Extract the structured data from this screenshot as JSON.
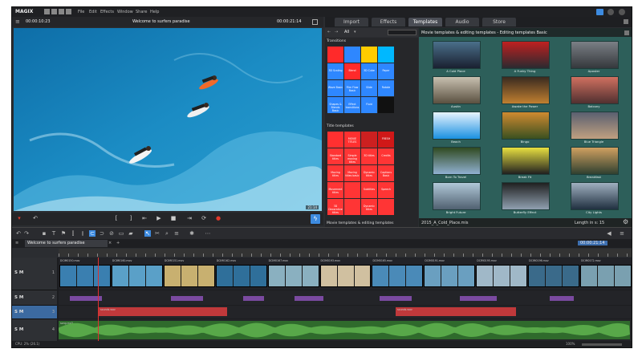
{
  "app": {
    "logo": "MAGIX"
  },
  "menu": [
    "File",
    "Edit",
    "Effects",
    "Window",
    "Share",
    "Help"
  ],
  "preview": {
    "timecode_left": "00:00:10:23",
    "title": "Welcome to surfers paradise",
    "timecode_right": "00:00:21:14",
    "progress_label": "21:14"
  },
  "tabs": [
    "Import",
    "Effects",
    "Templates",
    "Audio",
    "Store"
  ],
  "active_tab": "Templates",
  "library": {
    "filter": "All",
    "sections": [
      "Transitions",
      "Title templates",
      "Movie templates & editing templates"
    ],
    "transition_tiles": [
      {
        "label": "",
        "color": "#ff2a2a"
      },
      {
        "label": "",
        "color": "#2e87ff"
      },
      {
        "label": "",
        "color": "#ffcc00"
      },
      {
        "label": "",
        "color": "#00b8ff"
      },
      {
        "label": "3D Scaling",
        "color": "#2e87ff"
      },
      {
        "label": "Blend",
        "color": "#ff2a2a"
      },
      {
        "label": "3D Cube",
        "color": "#2e87ff"
      },
      {
        "label": "Paper",
        "color": "#2e87ff"
      },
      {
        "label": "Wave Basic",
        "color": "#2e87ff"
      },
      {
        "label": "Film Flow Basic",
        "color": "#2e87ff"
      },
      {
        "label": "Slide",
        "color": "#2e87ff"
      },
      {
        "label": "Rotate",
        "color": "#2e87ff"
      },
      {
        "label": "Shapes & Blends Basic",
        "color": "#2e87ff"
      },
      {
        "label": "Effect transitions",
        "color": "#2e87ff"
      },
      {
        "label": "Fluid",
        "color": "#2e87ff"
      },
      {
        "label": "",
        "color": "#111"
      }
    ],
    "title_tiles": [
      {
        "label": "",
        "color": "#ff3030"
      },
      {
        "label": "MOVIE TITLES",
        "color": "#ff3030"
      },
      {
        "label": "",
        "color": "#cc2020"
      },
      {
        "label": "FRESH",
        "color": "#d01818"
      },
      {
        "label": "Standard titles",
        "color": "#ff3535"
      },
      {
        "label": "Simple moving titles",
        "color": "#ff3535"
      },
      {
        "label": "3D titles",
        "color": "#ff3535"
      },
      {
        "label": "Credits",
        "color": "#ff3535"
      },
      {
        "label": "Moving titles",
        "color": "#ff3535"
      },
      {
        "label": "Moving titles basic",
        "color": "#ff3535"
      },
      {
        "label": "Dynamic titles",
        "color": "#ff3535"
      },
      {
        "label": "Captions Basic",
        "color": "#ff3535"
      },
      {
        "label": "Movement titles",
        "color": "#ff3535"
      },
      {
        "label": "",
        "color": "#ff3535"
      },
      {
        "label": "Subtitles",
        "color": "#ff3535"
      },
      {
        "label": "Speech",
        "color": "#ff3535"
      },
      {
        "label": "3D Decorative titles",
        "color": "#ff3535"
      },
      {
        "label": "",
        "color": "#ff3535"
      },
      {
        "label": "Dynamic titles",
        "color": "#ff3535"
      },
      {
        "label": "",
        "color": "#ff3535"
      }
    ]
  },
  "templates": {
    "header": "Movie templates & editing templates - Editing templates Basic",
    "items": [
      {
        "label": "A Cold Place",
        "c1": "#4a6f8a",
        "c2": "#1a2030"
      },
      {
        "label": "A Funky Thing",
        "c1": "#c02020",
        "c2": "#2a2a30"
      },
      {
        "label": "Aposter",
        "c1": "#7a7f85",
        "c2": "#35383c"
      },
      {
        "label": "Austin",
        "c1": "#c8c0b0",
        "c2": "#5a5040"
      },
      {
        "label": "Awake the Power",
        "c1": "#3a2a20",
        "c2": "#c08030"
      },
      {
        "label": "Balcony",
        "c1": "#d07060",
        "c2": "#503030"
      },
      {
        "label": "Beach",
        "c1": "#e8f4ff",
        "c2": "#1a90e0"
      },
      {
        "label": "Bingo",
        "c1": "#d08a30",
        "c2": "#3a5020"
      },
      {
        "label": "Blue Triangle",
        "c1": "#5a6070",
        "c2": "#c0a080"
      },
      {
        "label": "Born To Travel",
        "c1": "#304a20",
        "c2": "#90b0d0"
      },
      {
        "label": "Break Fit",
        "c1": "#e8e040",
        "c2": "#202020"
      },
      {
        "label": "Breakfast",
        "c1": "#d0a060",
        "c2": "#304030"
      },
      {
        "label": "Bright Future",
        "c1": "#b0c8d8",
        "c2": "#506070"
      },
      {
        "label": "Butterfly Effect",
        "c1": "#202020",
        "c2": "#90a0b0"
      },
      {
        "label": "City Lights",
        "c1": "#a0b0c0",
        "c2": "#203040"
      }
    ],
    "footer_file": "2015_A_Cold_Place.mis",
    "footer_length": "Length in s: 15"
  },
  "timeline": {
    "project_tab": "Welcome to surfers paradise",
    "timecode": "00:00:21:14",
    "tracks": [
      {
        "controls": "S M",
        "num": "1"
      },
      {
        "controls": "S M",
        "num": "2"
      },
      {
        "controls": "S M",
        "num": "3"
      },
      {
        "controls": "S M",
        "num": "4"
      }
    ],
    "clip_names": [
      "DCIM0150.mov",
      "DCIM0160.mov",
      "DCIM0151.mov",
      "DCIM0162.mov",
      "DCIM0167.mov",
      "DCIM0193.mov",
      "DCIM0165.mov",
      "DCIM0191.mov",
      "DCIM0195.mov",
      "DCIM0196.mov",
      "DCIM0172.mov"
    ],
    "audio_names": [
      "sounds.wav",
      "sounds.wav"
    ],
    "music_name": "song.mp3",
    "zoom": "100%"
  },
  "status": {
    "text": "CPU: 2%  (26.1)"
  }
}
